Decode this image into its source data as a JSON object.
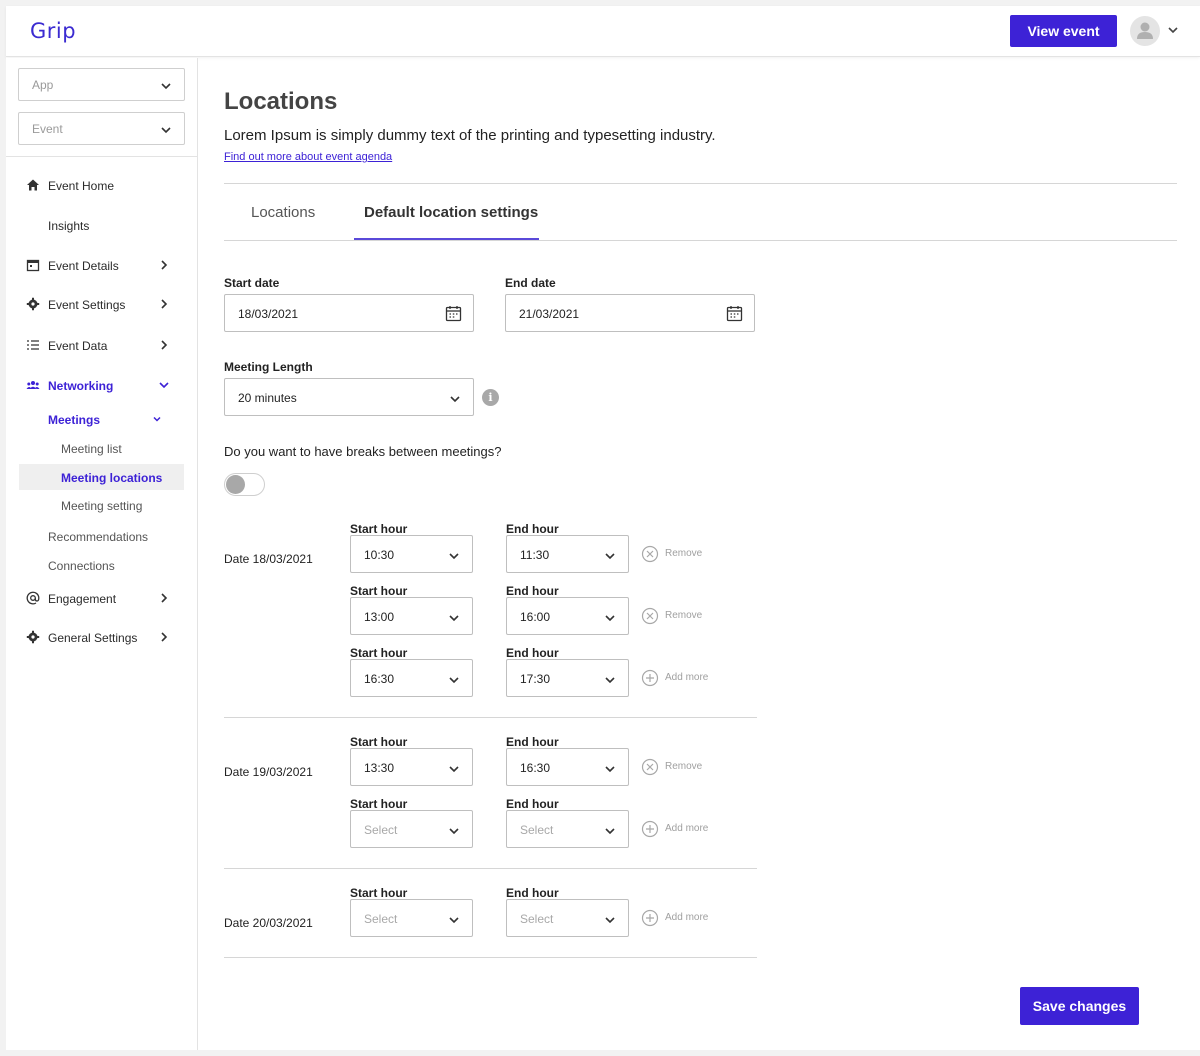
{
  "header": {
    "logo": "Grip",
    "view_event_label": "View event"
  },
  "sidebar": {
    "app_select": "App",
    "event_select": "Event",
    "items": [
      {
        "label": "Event Home"
      },
      {
        "label": "Insights"
      },
      {
        "label": "Event Details"
      },
      {
        "label": "Event Settings"
      },
      {
        "label": "Event Data"
      },
      {
        "label": "Networking"
      },
      {
        "label": "Engagement"
      },
      {
        "label": "General Settings"
      }
    ],
    "meetings_label": "Meetings",
    "meetings_children": [
      "Meeting list",
      "Meeting locations",
      "Meeting setting"
    ],
    "recommendations": "Recommendations",
    "connections": "Connections"
  },
  "page": {
    "title": "Locations",
    "description": "Lorem Ipsum is simply dummy text of the printing and typesetting industry.",
    "link": "Find out more about event agenda",
    "tabs": [
      "Locations",
      "Default location settings"
    ],
    "active_tab": 1
  },
  "form": {
    "start_date_label": "Start date",
    "start_date": "18/03/2021",
    "end_date_label": "End date",
    "end_date": "21/03/2021",
    "meeting_length_label": "Meeting Length",
    "meeting_length": "20 minutes",
    "breaks_question": "Do you want to have breaks between meetings?",
    "breaks_enabled": false,
    "start_hour_label": "Start hour",
    "end_hour_label": "End hour",
    "select_placeholder": "Select",
    "remove_label": "Remove",
    "add_more_label": "Add more"
  },
  "breaks": [
    {
      "date_label": "Date 18/03/2021",
      "slots": [
        {
          "start": "10:30",
          "end": "11:30",
          "action": "Remove"
        },
        {
          "start": "13:00",
          "end": "16:00",
          "action": "Remove"
        },
        {
          "start": "16:30",
          "end": "17:30",
          "action": "Add more"
        }
      ]
    },
    {
      "date_label": "Date 19/03/2021",
      "slots": [
        {
          "start": "13:30",
          "end": "16:30",
          "action": "Remove"
        },
        {
          "start": "",
          "end": "",
          "action": "Add more"
        }
      ]
    },
    {
      "date_label": "Date 20/03/2021",
      "slots": [
        {
          "start": "",
          "end": "",
          "action": "Add more"
        }
      ]
    }
  ],
  "save_label": "Save changes",
  "colors": {
    "accent": "#3d22d6",
    "muted": "#a8a8a8"
  }
}
